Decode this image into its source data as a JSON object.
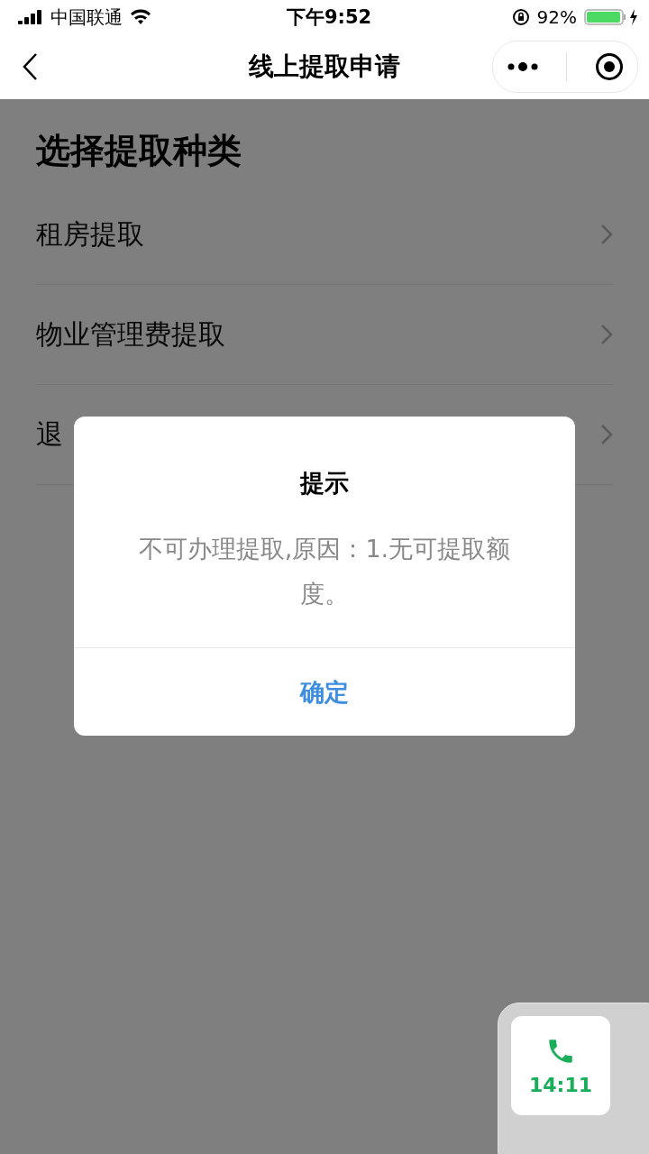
{
  "status_bar": {
    "carrier": "中国联通",
    "time": "下午9:52",
    "battery": "92%"
  },
  "nav_bar": {
    "title": "线上提取申请"
  },
  "page": {
    "heading": "选择提取种类",
    "items": [
      {
        "label": "租房提取"
      },
      {
        "label": "物业管理费提取"
      },
      {
        "label": "退"
      }
    ]
  },
  "dialog": {
    "title": "提示",
    "message": "不可办理提取,原因：1.无可提取额度。",
    "button": "确定"
  },
  "call_widget": {
    "duration": "14:11"
  }
}
